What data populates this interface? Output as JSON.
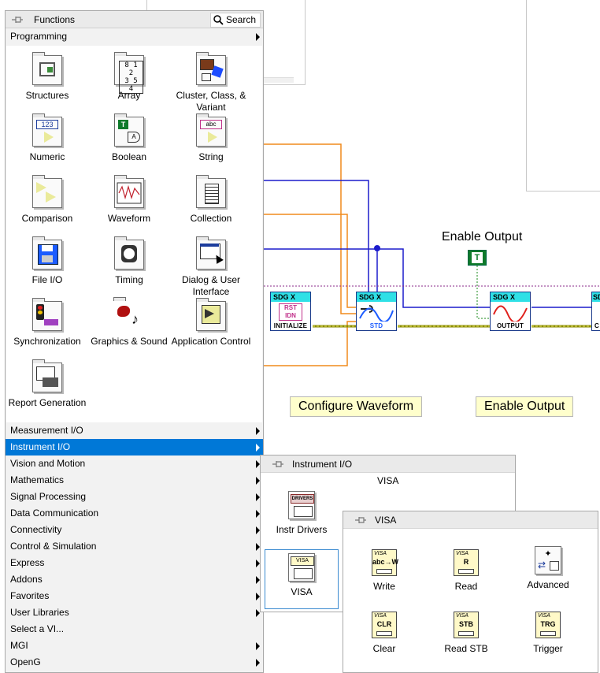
{
  "palette": {
    "title": "Functions",
    "search_label": "Search",
    "top_category": "Programming",
    "tiles": [
      {
        "label": "Structures",
        "icon": "structures-icon"
      },
      {
        "label": "Array",
        "icon": "array-icon"
      },
      {
        "label": "Cluster, Class, & Variant",
        "icon": "cluster-icon"
      },
      {
        "label": "Numeric",
        "icon": "numeric-icon"
      },
      {
        "label": "Boolean",
        "icon": "boolean-icon"
      },
      {
        "label": "String",
        "icon": "string-icon"
      },
      {
        "label": "Comparison",
        "icon": "comparison-icon"
      },
      {
        "label": "Waveform",
        "icon": "waveform-icon"
      },
      {
        "label": "Collection",
        "icon": "collection-icon"
      },
      {
        "label": "File I/O",
        "icon": "file-io-icon"
      },
      {
        "label": "Timing",
        "icon": "timing-icon"
      },
      {
        "label": "Dialog & User Interface",
        "icon": "dialog-icon"
      },
      {
        "label": "Synchronization",
        "icon": "synchronization-icon"
      },
      {
        "label": "Graphics & Sound",
        "icon": "graphics-icon"
      },
      {
        "label": "Application Control",
        "icon": "application-control-icon"
      },
      {
        "label": "Report Generation",
        "icon": "report-icon"
      }
    ],
    "menu": [
      {
        "label": "Measurement I/O",
        "arrow": true,
        "selected": false
      },
      {
        "label": "Instrument I/O",
        "arrow": true,
        "selected": true
      },
      {
        "label": "Vision and Motion",
        "arrow": true,
        "selected": false
      },
      {
        "label": "Mathematics",
        "arrow": true,
        "selected": false
      },
      {
        "label": "Signal Processing",
        "arrow": true,
        "selected": false
      },
      {
        "label": "Data Communication",
        "arrow": true,
        "selected": false
      },
      {
        "label": "Connectivity",
        "arrow": true,
        "selected": false
      },
      {
        "label": "Control & Simulation",
        "arrow": true,
        "selected": false
      },
      {
        "label": "Express",
        "arrow": true,
        "selected": false
      },
      {
        "label": "Addons",
        "arrow": true,
        "selected": false
      },
      {
        "label": "Favorites",
        "arrow": true,
        "selected": false
      },
      {
        "label": "User Libraries",
        "arrow": true,
        "selected": false
      },
      {
        "label": "Select a VI...",
        "arrow": false,
        "selected": false
      },
      {
        "label": "MGI",
        "arrow": true,
        "selected": false
      },
      {
        "label": "OpenG",
        "arrow": true,
        "selected": false
      }
    ]
  },
  "instrument_io": {
    "title": "Instrument I/O",
    "section_label": "VISA",
    "items": [
      {
        "label": "Instr Drivers",
        "badge": "DRIVERS"
      },
      {
        "label": "VISA",
        "badge": "VISA"
      }
    ]
  },
  "visa_palette": {
    "title": "VISA",
    "items": [
      {
        "label": "Write",
        "glyph": "abc→W"
      },
      {
        "label": "Read",
        "glyph": "R"
      },
      {
        "label": "Advanced",
        "glyph": "⇄"
      },
      {
        "label": "Clear",
        "glyph": "CLR"
      },
      {
        "label": "Read STB",
        "glyph": "STB"
      },
      {
        "label": "Trigger",
        "glyph": "TRG"
      }
    ]
  },
  "diagram": {
    "enable_output_label": "Enable Output",
    "bool_constant": "T",
    "nodes": [
      {
        "header": "SDG X",
        "footer": "INITIALIZE",
        "inner": "RST IDN"
      },
      {
        "header": "SDG X",
        "footer": "STD",
        "inner": ""
      },
      {
        "header": "SDG X",
        "footer": "OUTPUT",
        "inner": ""
      },
      {
        "header": "SDG",
        "footer": "C",
        "inner": ""
      }
    ],
    "free_labels": [
      "Configure Waveform",
      "Enable Output"
    ],
    "colors": {
      "orange_wire": "#f08a1c",
      "blue_wire": "#1c1ccc",
      "error_wire": "#c8c800",
      "purple_wire": "#8a2a8a",
      "node_header": "#2fe0e6",
      "selection": "#0078d7"
    }
  }
}
